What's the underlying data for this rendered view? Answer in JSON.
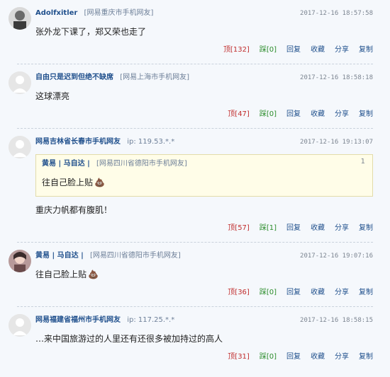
{
  "comments": [
    {
      "user": "Adolfxitler",
      "location": "[网易重庆市手机网友]",
      "time": "2017-12-16 18:57:58",
      "text": "张外龙下课了，郑又荣也走了",
      "actions": {
        "up": "顶[132]",
        "down": "踩[0]",
        "reply": "回复",
        "fav": "收藏",
        "share": "分享",
        "copy": "复制"
      }
    },
    {
      "user": "自由只是迟到但绝不缺席",
      "location": "[网易上海市手机网友]",
      "time": "2017-12-16 18:58:18",
      "text": "这球漂亮",
      "actions": {
        "up": "顶[47]",
        "down": "踩[0]",
        "reply": "回复",
        "fav": "收藏",
        "share": "分享",
        "copy": "复制"
      }
    },
    {
      "user": "网易吉林省长春市手机网友",
      "ip": "ip: 119.53.*.*",
      "time": "2017-12-16 19:13:07",
      "quote": {
        "user": "黄易 | 马自达 |",
        "location": "[网易四川省德阳市手机网友]",
        "floor": "1",
        "text": "往自己脸上贴"
      },
      "text": "重庆力帆都有腹肌！",
      "actions": {
        "up": "顶[57]",
        "down": "踩[1]",
        "reply": "回复",
        "fav": "收藏",
        "share": "分享",
        "copy": "复制"
      }
    },
    {
      "user": "黄易 | 马自达 |",
      "location": "[网易四川省德阳市手机网友]",
      "time": "2017-12-16 19:07:16",
      "text": "往自己脸上贴",
      "actions": {
        "up": "顶[36]",
        "down": "踩[0]",
        "reply": "回复",
        "fav": "收藏",
        "share": "分享",
        "copy": "复制"
      }
    },
    {
      "user": "网易福建省福州市手机网友",
      "ip": "ip: 117.25.*.*",
      "time": "2017-12-16 18:58:15",
      "text": "…来中国旅游过的人里还有还很多被加持过的高人",
      "actions": {
        "up": "顶[31]",
        "down": "踩[0]",
        "reply": "回复",
        "fav": "收藏",
        "share": "分享",
        "copy": "复制"
      }
    }
  ],
  "icons": {
    "poop": "💩"
  },
  "colors": {
    "link": "#1f4f8c",
    "count": "#c12e2e",
    "quoteBg": "#fffde8"
  }
}
